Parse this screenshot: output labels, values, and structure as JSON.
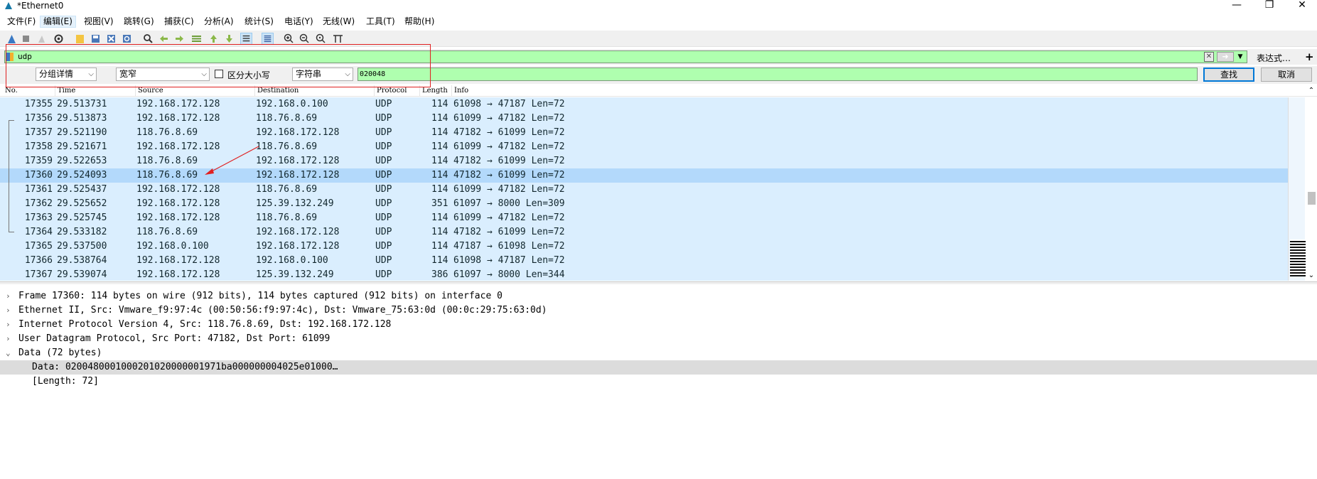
{
  "window": {
    "title": "*Ethernet0",
    "controls": [
      "—",
      "❐",
      "✕"
    ]
  },
  "menu": [
    "文件(F)",
    "编辑(E)",
    "视图(V)",
    "跳转(G)",
    "捕获(C)",
    "分析(A)",
    "统计(S)",
    "电话(Y)",
    "无线(W)",
    "工具(T)",
    "帮助(H)"
  ],
  "filter": {
    "value": "udp",
    "expression_label": "表达式…",
    "plus_label": "+",
    "colors": {
      "valid_bg": "#afffaf"
    }
  },
  "find": {
    "search_in": "分组详情",
    "char_width": "宽窄",
    "case_label": "区分大小写",
    "search_type": "字符串",
    "value": "020048",
    "find_button": "查找",
    "cancel_button": "取消"
  },
  "columns": [
    "No.",
    "Time",
    "Source",
    "Destination",
    "Protocol",
    "Length",
    "Info"
  ],
  "packets": [
    {
      "no": "17355",
      "time": "29.513731",
      "src": "192.168.172.128",
      "dst": "192.168.0.100",
      "proto": "UDP",
      "len": "114",
      "info": "61098 → 47187 Len=72"
    },
    {
      "no": "17356",
      "time": "29.513873",
      "src": "192.168.172.128",
      "dst": "118.76.8.69",
      "proto": "UDP",
      "len": "114",
      "info": "61099 → 47182 Len=72"
    },
    {
      "no": "17357",
      "time": "29.521190",
      "src": "118.76.8.69",
      "dst": "192.168.172.128",
      "proto": "UDP",
      "len": "114",
      "info": "47182 → 61099 Len=72"
    },
    {
      "no": "17358",
      "time": "29.521671",
      "src": "192.168.172.128",
      "dst": "118.76.8.69",
      "proto": "UDP",
      "len": "114",
      "info": "61099 → 47182 Len=72"
    },
    {
      "no": "17359",
      "time": "29.522653",
      "src": "118.76.8.69",
      "dst": "192.168.172.128",
      "proto": "UDP",
      "len": "114",
      "info": "47182 → 61099 Len=72"
    },
    {
      "no": "17360",
      "time": "29.524093",
      "src": "118.76.8.69",
      "dst": "192.168.172.128",
      "proto": "UDP",
      "len": "114",
      "info": "47182 → 61099 Len=72",
      "selected": true
    },
    {
      "no": "17361",
      "time": "29.525437",
      "src": "192.168.172.128",
      "dst": "118.76.8.69",
      "proto": "UDP",
      "len": "114",
      "info": "61099 → 47182 Len=72"
    },
    {
      "no": "17362",
      "time": "29.525652",
      "src": "192.168.172.128",
      "dst": "125.39.132.249",
      "proto": "UDP",
      "len": "351",
      "info": "61097 → 8000 Len=309"
    },
    {
      "no": "17363",
      "time": "29.525745",
      "src": "192.168.172.128",
      "dst": "118.76.8.69",
      "proto": "UDP",
      "len": "114",
      "info": "61099 → 47182 Len=72"
    },
    {
      "no": "17364",
      "time": "29.533182",
      "src": "118.76.8.69",
      "dst": "192.168.172.128",
      "proto": "UDP",
      "len": "114",
      "info": "47182 → 61099 Len=72"
    },
    {
      "no": "17365",
      "time": "29.537500",
      "src": "192.168.0.100",
      "dst": "192.168.172.128",
      "proto": "UDP",
      "len": "114",
      "info": "47187 → 61098 Len=72"
    },
    {
      "no": "17366",
      "time": "29.538764",
      "src": "192.168.172.128",
      "dst": "192.168.0.100",
      "proto": "UDP",
      "len": "114",
      "info": "61098 → 47187 Len=72"
    },
    {
      "no": "17367",
      "time": "29.539074",
      "src": "192.168.172.128",
      "dst": "125.39.132.249",
      "proto": "UDP",
      "len": "386",
      "info": "61097 → 8000 Len=344"
    }
  ],
  "details": [
    {
      "twisty": "›",
      "text": "Frame 17360: 114 bytes on wire (912 bits), 114 bytes captured (912 bits) on interface 0"
    },
    {
      "twisty": "›",
      "text": "Ethernet II, Src: Vmware_f9:97:4c (00:50:56:f9:97:4c), Dst: Vmware_75:63:0d (00:0c:29:75:63:0d)"
    },
    {
      "twisty": "›",
      "text": "Internet Protocol Version 4, Src: 118.76.8.69, Dst: 192.168.172.128"
    },
    {
      "twisty": "›",
      "text": "User Datagram Protocol, Src Port: 47182, Dst Port: 61099"
    },
    {
      "twisty": "⌄",
      "text": "Data (72 bytes)"
    },
    {
      "twisty": "",
      "text": "Data: 0200480001000201020000001971ba000000004025e01000…",
      "indent": 1,
      "highlight": true
    },
    {
      "twisty": "",
      "text": "[Length: 72]",
      "indent": 1
    }
  ],
  "colors": {
    "row_bg": "#daeefe",
    "row_selected_bg": "#b3d9fb",
    "annotation": "#e02020"
  }
}
